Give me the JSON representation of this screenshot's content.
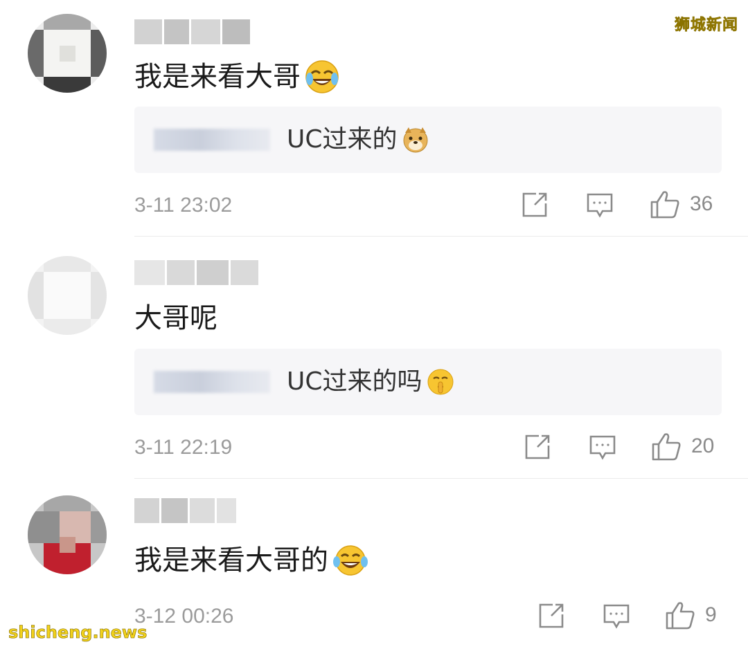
{
  "watermarks": {
    "top_right": "狮城新闻",
    "bottom_left": "shicheng.news"
  },
  "comments": [
    {
      "text": "我是来看大哥",
      "emoji": "crying-laughing-emoji",
      "reply": {
        "text": "UC过来的",
        "emoji": "doge-emoji"
      },
      "time": "3-11 23:02",
      "likes": "36"
    },
    {
      "text": "大哥呢",
      "emoji": "",
      "reply": {
        "text": "UC过来的吗",
        "emoji": "shushing-face-emoji"
      },
      "time": "3-11 22:19",
      "likes": "20"
    },
    {
      "text": "我是来看大哥的",
      "emoji": "tears-of-joy-emoji",
      "reply": null,
      "time": "3-12 00:26",
      "likes": "9"
    }
  ],
  "colors": {
    "meta_gray": "#9b9b9b",
    "reply_bg": "#f6f6f8",
    "watermark_yellow": "#f2d21b"
  }
}
